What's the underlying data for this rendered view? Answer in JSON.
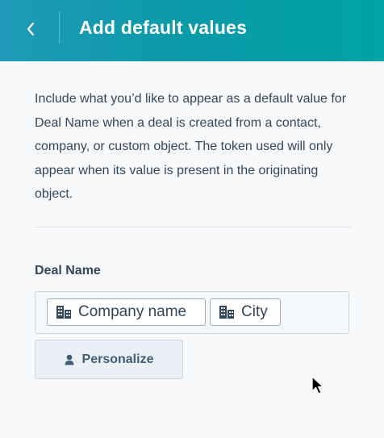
{
  "header": {
    "title": "Add default values",
    "back_icon": "chevron-left-icon",
    "background_color": "#1f9ab8"
  },
  "main": {
    "description": "Include what you’d like to appear as a default value for Deal Name when a deal is created from a contact, company, or custom object. The token used will only appear when its value is present in the originating object.",
    "field_label": "Deal Name",
    "tokens": [
      {
        "label": "Company name",
        "icon": "building-icon"
      },
      {
        "label": "City",
        "icon": "building-icon"
      }
    ],
    "personalize_button": {
      "label": "Personalize",
      "icon": "person-icon"
    }
  }
}
